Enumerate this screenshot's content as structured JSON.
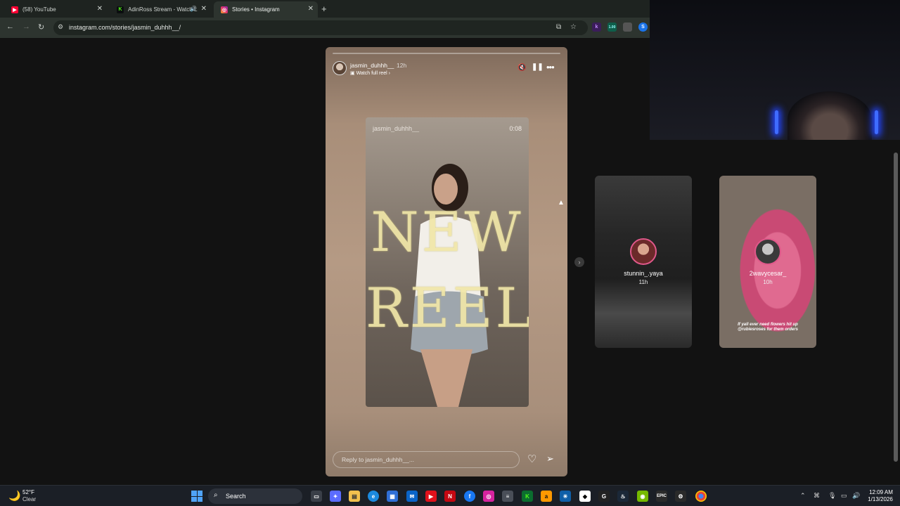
{
  "browser": {
    "tabs": [
      {
        "title": "(58) YouTube",
        "favicon": "youtube-icon",
        "color": "#ff0033"
      },
      {
        "title": "AdinRoss Stream - Watch L",
        "favicon": "kick-icon",
        "color": "#53fc18"
      },
      {
        "title": "Stories • Instagram",
        "favicon": "instagram-icon",
        "color": "#e1306c"
      }
    ],
    "new_tab": "+",
    "url": "instagram.com/stories/jasmin_duhhh__/",
    "extensions": [
      "k",
      "1.00",
      "",
      "S"
    ]
  },
  "story": {
    "username": "jasmin_duhhh__",
    "time": "12h",
    "watch_full": "Watch full reel",
    "reel": {
      "username": "jasmin_duhhh__",
      "duration": "0:08",
      "overlay_line1": "NEW",
      "overlay_line2": "REEL"
    },
    "reply_placeholder": "Reply to jasmin_duhhh__..."
  },
  "previews": [
    {
      "username": "stunnin_.yaya",
      "time": "11h"
    },
    {
      "username": "2wavycesar_",
      "time": "10h",
      "caption_line1": "If yall ever need flowers hit up",
      "caption_line2": "@rubiesroses for them orders"
    }
  ],
  "taskbar": {
    "weather_temp": "52°F",
    "weather_desc": "Clear",
    "search_label": "Search",
    "clock_time": "12:09 AM",
    "clock_date": "1/13/2026"
  },
  "colors": {
    "accent": "#e0588a",
    "taskbar": "#1b1f26",
    "chrome": "#2d342f"
  }
}
